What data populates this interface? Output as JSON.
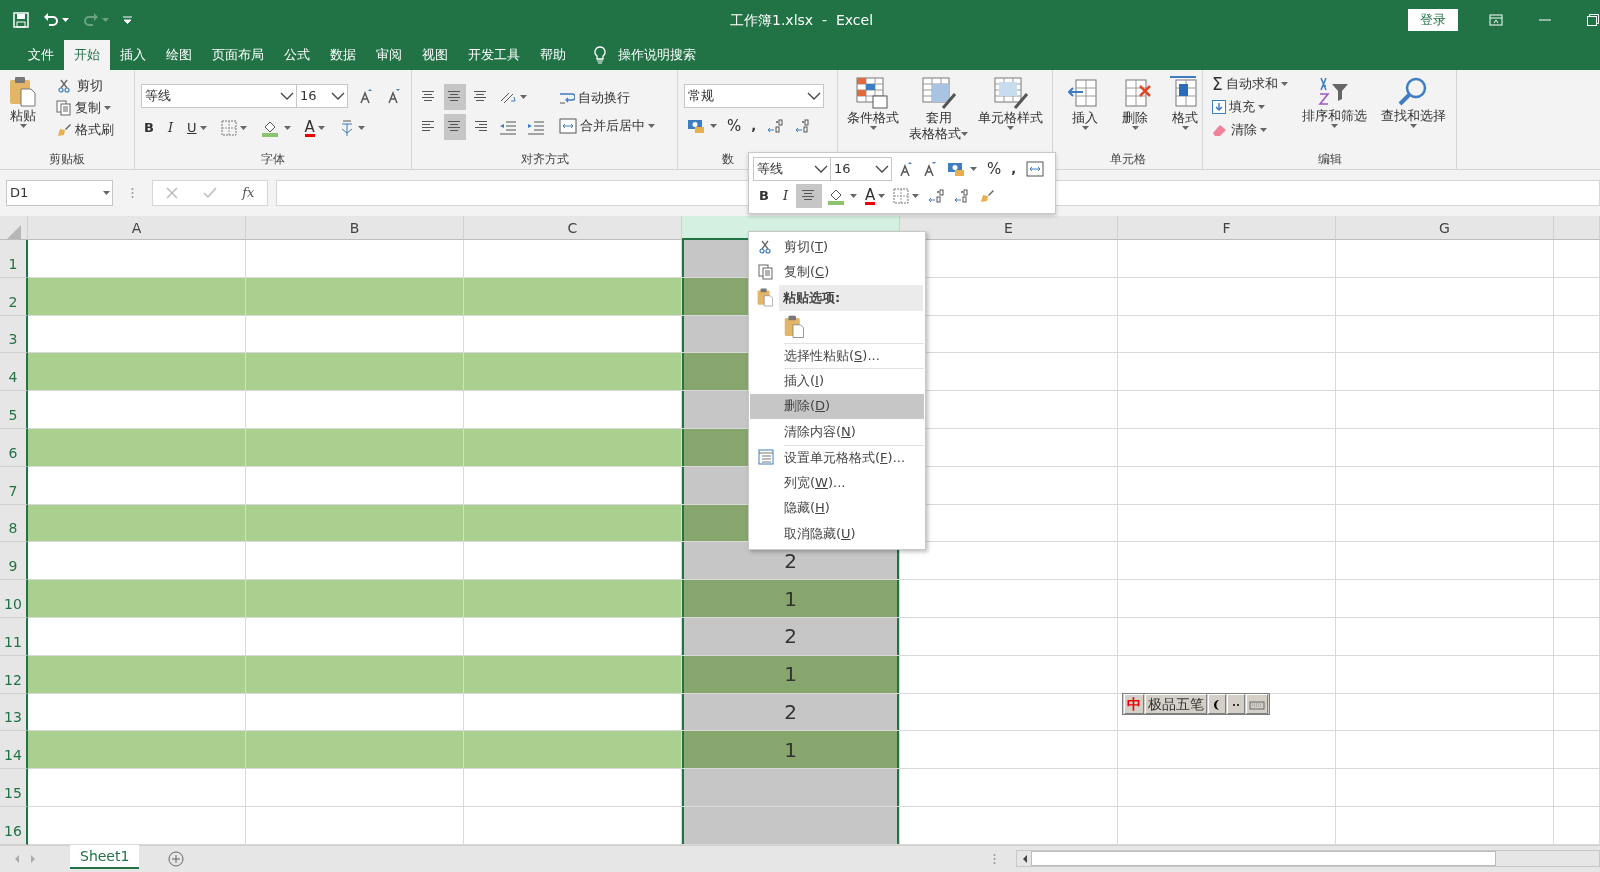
{
  "title_bar": {
    "title": "工作簿1.xlsx  -  Excel",
    "login": "登录"
  },
  "menu_tabs": [
    {
      "label": "文件",
      "selected": false
    },
    {
      "label": "开始",
      "selected": true
    },
    {
      "label": "插入",
      "selected": false
    },
    {
      "label": "绘图",
      "selected": false
    },
    {
      "label": "页面布局",
      "selected": false
    },
    {
      "label": "公式",
      "selected": false
    },
    {
      "label": "数据",
      "selected": false
    },
    {
      "label": "审阅",
      "selected": false
    },
    {
      "label": "视图",
      "selected": false
    },
    {
      "label": "开发工具",
      "selected": false
    },
    {
      "label": "帮助",
      "selected": false
    }
  ],
  "tell_me": "操作说明搜索",
  "ribbon": {
    "clipboard": {
      "paste": "粘贴",
      "items": [
        "剪切",
        "复制",
        "格式刷"
      ],
      "label": "剪贴板"
    },
    "font": {
      "name": "等线",
      "size": "16",
      "bold": "B",
      "italic": "I",
      "underline": "U",
      "font_color": "A",
      "label": "字体"
    },
    "alignment": {
      "wrap": "自动换行",
      "merge": "合并后居中",
      "label": "对齐方式"
    },
    "number": {
      "format": "常规",
      "percent": "%",
      "comma": ",",
      "label": "数"
    },
    "styles": [
      {
        "lines": [
          "条件格式"
        ]
      },
      {
        "lines": [
          "套用",
          "表格格式"
        ]
      },
      {
        "lines": [
          "单元格样式"
        ]
      }
    ],
    "cells": {
      "items": [
        "插入",
        "删除",
        "格式"
      ],
      "label": "单元格"
    },
    "editing": {
      "sigma": "Σ",
      "small": [
        "自动求和",
        "填充",
        "清除"
      ],
      "big": [
        "排序和筛选",
        "查找和选择"
      ],
      "label": "编辑"
    }
  },
  "mini_toolbar": {
    "font": "等线",
    "size": "16",
    "percent": "%",
    "comma": ",",
    "bold": "B",
    "italic": "I",
    "font_color": "A"
  },
  "formula_bar": {
    "name_box": "D1",
    "fx": "fx"
  },
  "columns": [
    {
      "label": "A",
      "selected": false,
      "in_table": true
    },
    {
      "label": "B",
      "selected": false,
      "in_table": true
    },
    {
      "label": "C",
      "selected": false,
      "in_table": true
    },
    {
      "selected": true,
      "in_table": true
    },
    {
      "label": "E",
      "selected": false,
      "in_table": false
    },
    {
      "label": "F",
      "selected": false,
      "in_table": false
    },
    {
      "label": "G",
      "selected": false,
      "in_table": false
    }
  ],
  "rows": [
    {
      "label": "1",
      "shaded": false
    },
    {
      "label": "2",
      "shaded": true
    },
    {
      "label": "3",
      "shaded": false
    },
    {
      "label": "4",
      "shaded": true
    },
    {
      "label": "5",
      "shaded": false
    },
    {
      "label": "6",
      "shaded": true
    },
    {
      "label": "7",
      "shaded": false
    },
    {
      "label": "8",
      "shaded": true
    },
    {
      "label": "9",
      "shaded": false,
      "d": "2"
    },
    {
      "label": "10",
      "shaded": true,
      "d": "1"
    },
    {
      "label": "11",
      "shaded": false,
      "d": "2"
    },
    {
      "label": "12",
      "shaded": true,
      "d": "1"
    },
    {
      "label": "13",
      "shaded": false,
      "d": "2"
    },
    {
      "label": "14",
      "shaded": true,
      "d": "1"
    },
    {
      "label": "15",
      "shaded": false
    },
    {
      "label": "16",
      "shaded": false
    }
  ],
  "context_menu": [
    {
      "kind": "command",
      "text": "剪切(",
      "key": "T",
      "tail": ")",
      "selected": false
    },
    {
      "kind": "command",
      "text": "复制(",
      "key": "C",
      "tail": ")",
      "selected": false
    },
    {
      "kind": "header",
      "text": "粘贴选项:"
    },
    {
      "kind": "paste-option"
    },
    {
      "kind": "command",
      "text": "选择性粘贴(",
      "key": "S",
      "tail": ")...",
      "selected": false
    },
    {
      "kind": "command",
      "text": "插入(",
      "key": "I",
      "tail": ")",
      "selected": false
    },
    {
      "kind": "command",
      "text": "删除(",
      "key": "D",
      "tail": ")",
      "selected": true
    },
    {
      "kind": "command",
      "text": "清除内容(",
      "key": "N",
      "tail": ")",
      "selected": false
    },
    {
      "kind": "command",
      "text": "设置单元格格式(",
      "key": "F",
      "tail": ")...",
      "selected": false
    },
    {
      "kind": "command",
      "text": "列宽(",
      "key": "W",
      "tail": ")...",
      "selected": false
    },
    {
      "kind": "command",
      "text": "隐藏(",
      "key": "H",
      "tail": ")",
      "selected": false
    },
    {
      "kind": "command",
      "text": "取消隐藏(",
      "key": "U",
      "tail": ")",
      "selected": false
    }
  ],
  "sheet_tabs": [
    {
      "label": "Sheet1",
      "selected": true
    }
  ],
  "ime": {
    "mode": "中",
    "label": "极品五笔"
  }
}
